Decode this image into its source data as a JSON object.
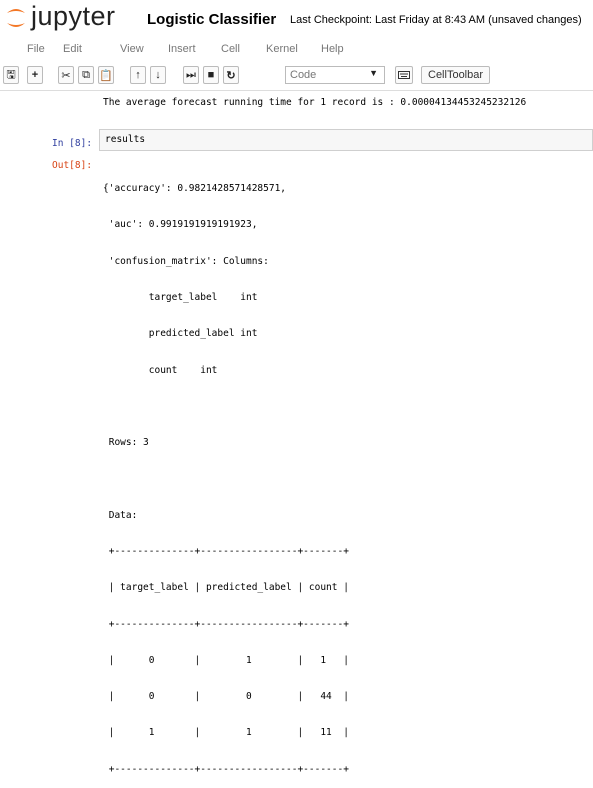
{
  "header": {
    "logo_text": "jupyter",
    "notebook_title": "Logistic Classifier",
    "checkpoint": "Last Checkpoint: Last Friday at 8:43 AM (unsaved changes)"
  },
  "menu": [
    "File",
    "Edit",
    "View",
    "Insert",
    "Cell",
    "Kernel",
    "Help"
  ],
  "toolbar": {
    "icons": [
      "save-icon",
      "add-cell-icon",
      "cut-icon",
      "copy-icon",
      "paste-icon",
      "move-up-icon",
      "move-down-icon",
      "run-icon",
      "stop-icon",
      "restart-icon"
    ],
    "glyphs": [
      "🖫",
      "+",
      "✂",
      "⧉",
      "📋",
      "↑",
      "↓",
      "⏭",
      "■",
      "↻"
    ],
    "cell_type": "Code",
    "keyboard_icon": "keyboard-icon",
    "celltoolbar_label": "CellToolbar"
  },
  "notebook": {
    "prev_output": "The average forecast running time for 1 record is : 0.00004134453245232126",
    "in_prompt": "In [8]:",
    "input": "results",
    "out_prompt": "Out[8]:",
    "output_lines": [
      "{'accuracy': 0.9821428571428571,",
      " 'auc': 0.9919191919191923,",
      " 'confusion_matrix': Columns:",
      "        target_label    int",
      "        predicted_label int",
      "        count    int",
      "",
      " Rows: 3",
      "",
      " Data:",
      " +--------------+-----------------+-------+",
      " | target_label | predicted_label | count |",
      " +--------------+-----------------+-------+",
      " |      0       |        1        |   1   |",
      " |      0       |        0        |   44  |",
      " |      1       |        1        |   11  |",
      " +--------------+-----------------+-------+"
    ]
  }
}
